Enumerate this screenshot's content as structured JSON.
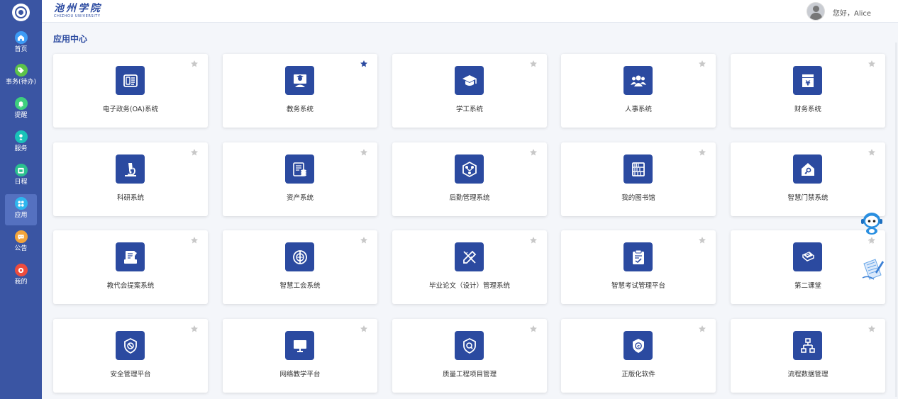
{
  "brand": {
    "name_cn": "池州学院",
    "name_en": "CHIZHOU UNIVERSITY"
  },
  "user": {
    "greeting": "您好，Alice"
  },
  "page_title": "应用中心",
  "sidebar": {
    "items": [
      {
        "label": "首页",
        "icon": "home-icon",
        "color": "#3d9bf5"
      },
      {
        "label": "事务(待办)",
        "icon": "tag-icon",
        "color": "#5cc24a"
      },
      {
        "label": "提醒",
        "icon": "bell-icon",
        "color": "#3ecf7e"
      },
      {
        "label": "服务",
        "icon": "user-badge-icon",
        "color": "#19c2b9"
      },
      {
        "label": "日程",
        "icon": "calendar-icon",
        "color": "#2bbf8f"
      },
      {
        "label": "应用",
        "icon": "apps-icon",
        "color": "#2fb6ee",
        "active": true
      },
      {
        "label": "公告",
        "icon": "chat-icon",
        "color": "#f4a43a"
      },
      {
        "label": "我的",
        "icon": "gear-icon",
        "color": "#ee4c3d"
      }
    ]
  },
  "apps": [
    {
      "label": "电子政务(OA)系统",
      "icon": "id-card-icon",
      "starred": false
    },
    {
      "label": "教务系统",
      "icon": "teacher-icon",
      "starred": true
    },
    {
      "label": "学工系统",
      "icon": "graduation-cap-icon",
      "starred": false
    },
    {
      "label": "人事系统",
      "icon": "people-icon",
      "starred": false
    },
    {
      "label": "财务系统",
      "icon": "yen-icon",
      "starred": false
    },
    {
      "label": "科研系统",
      "icon": "microscope-icon",
      "starred": false
    },
    {
      "label": "资产系统",
      "icon": "coins-icon",
      "starred": false
    },
    {
      "label": "后勤管理系统",
      "icon": "logistics-icon",
      "starred": false
    },
    {
      "label": "我的图书馆",
      "icon": "bookshelf-icon",
      "starred": false
    },
    {
      "label": "智慧门禁系统",
      "icon": "house-key-icon",
      "starred": false
    },
    {
      "label": "教代会提案系统",
      "icon": "proposal-icon",
      "starred": false
    },
    {
      "label": "智慧工会系统",
      "icon": "union-icon",
      "starred": false
    },
    {
      "label": "毕业论文（设计）管理系统",
      "icon": "pencil-ruler-icon",
      "starred": false
    },
    {
      "label": "智慧考试管理平台",
      "icon": "clipboard-check-icon",
      "starred": false
    },
    {
      "label": "第二课堂",
      "icon": "book-icon",
      "starred": false
    },
    {
      "label": "安全管理平台",
      "icon": "shield-block-icon",
      "starred": false
    },
    {
      "label": "网络教学平台",
      "icon": "monitor-icon",
      "starred": false
    },
    {
      "label": "质量工程项目管理",
      "icon": "shield-search-icon",
      "starred": false
    },
    {
      "label": "正版化软件",
      "icon": "shield-copyright-icon",
      "starred": false
    },
    {
      "label": "流程数据管理",
      "icon": "flowchart-icon",
      "starred": false
    }
  ],
  "colors": {
    "sidebar": "#3a55a3",
    "accent": "#2b4aa0",
    "star_off": "#c8c8c8",
    "star_on": "#2b4aa0"
  }
}
